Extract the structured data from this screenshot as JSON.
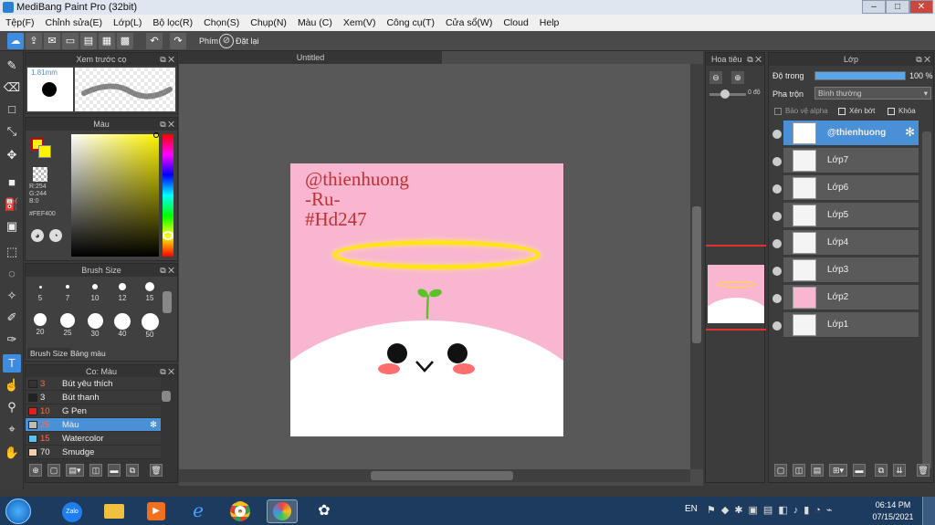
{
  "window": {
    "title": "MediBang Paint Pro (32bit)",
    "min": "–",
    "max": "□",
    "close": "✕"
  },
  "menu": [
    "Tệp(F)",
    "Chỉnh sửa(E)",
    "Lớp(L)",
    "Bộ lọc(R)",
    "Chọn(S)",
    "Chụp(N)",
    "Màu (C)",
    "Xem(V)",
    "Công cụ(T)",
    "Cửa sổ(W)",
    "Cloud",
    "Help"
  ],
  "toolbar": {
    "snap_label": "Phím",
    "reset_label": "Đặt lại"
  },
  "preview": {
    "title": "Xem trước cọ",
    "size": "1.81mm"
  },
  "color": {
    "title": "Màu",
    "r": "R:254",
    "g": "G:244",
    "b": "B:0",
    "hex": "#FEF400",
    "primary": "#FEF400"
  },
  "brush_size": {
    "title": "Brush Size",
    "sizes": [
      "5",
      "7",
      "10",
      "12",
      "15",
      "20",
      "25",
      "30",
      "40",
      "50"
    ],
    "tabs": [
      "Brush Size",
      "Bảng màu"
    ]
  },
  "brushes": {
    "title": "Co: Màu",
    "items": [
      {
        "size": "3",
        "name": "Bút yêu thích",
        "color": "#333333"
      },
      {
        "size": "3",
        "name": "Bút thanh",
        "color": "#222222"
      },
      {
        "size": "10",
        "name": "G Pen",
        "color": "#e02020"
      },
      {
        "size": "25",
        "name": "Màu",
        "color": "#bbbbbb"
      },
      {
        "size": "15",
        "name": "Watercolor",
        "color": "#5bc0f0"
      },
      {
        "size": "70",
        "name": "Smudge",
        "color": "#f0d0b0"
      }
    ]
  },
  "canvas": {
    "doc_title": "Untitled",
    "text_line1": "@thienhuong",
    "text_line2": "-Ru-",
    "text_line3": "#Hd247",
    "bg": "#f9b6d0"
  },
  "navigator": {
    "title": "Hoa tiêu",
    "angle": "0 độ"
  },
  "layers": {
    "title": "Lớp",
    "opacity_label": "Độ trong",
    "opacity_value": "100 %",
    "opacity": 1.0,
    "blend_label": "Pha trộn",
    "blend_value": "Bình thường",
    "protect_alpha": "Bảo vệ alpha",
    "clipping": "Xén bớt",
    "lock": "Khóa",
    "items": [
      "@thienhuong",
      "Lớp7",
      "Lớp6",
      "Lớp5",
      "Lớp4",
      "Lớp3",
      "Lớp2",
      "Lớp1"
    ]
  },
  "taskbar": {
    "lang": "EN",
    "time": "06:14 PM",
    "date": "07/15/2021",
    "zalo": "Zalo"
  }
}
